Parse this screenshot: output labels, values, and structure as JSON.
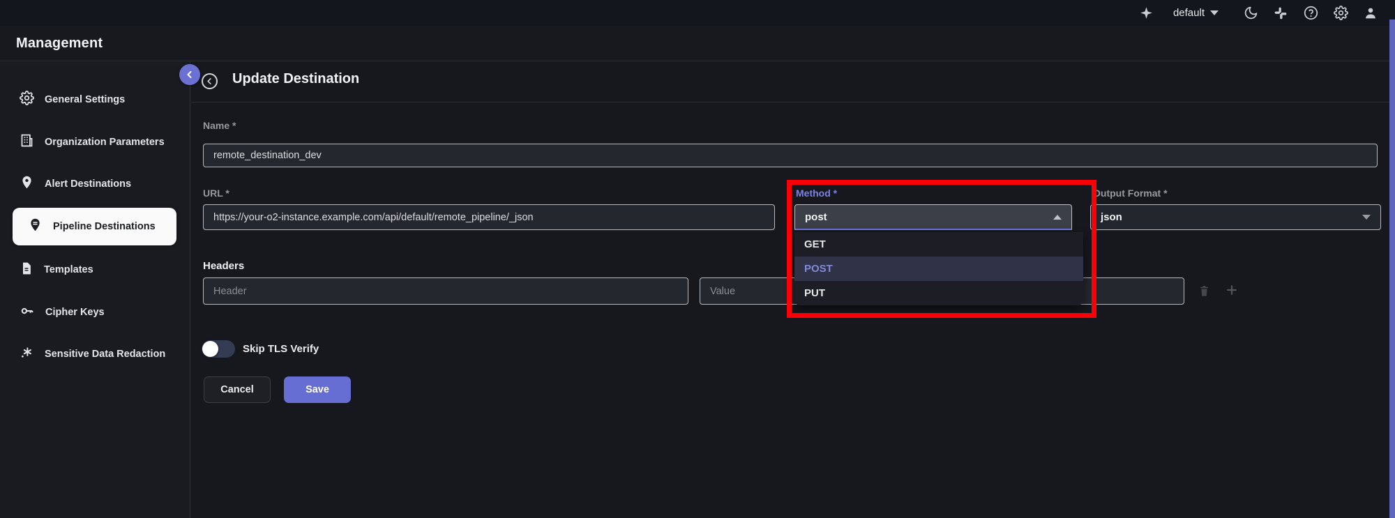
{
  "topbar": {
    "org_selector": {
      "value": "default"
    },
    "icon_names": [
      "sparkle-icon",
      "theme-moon-icon",
      "slack-icon",
      "help-icon",
      "settings-icon",
      "profile-icon"
    ]
  },
  "app_header": {
    "title": "Management"
  },
  "sidebar": {
    "items": [
      {
        "label": "General Settings",
        "icon": "gear-icon",
        "active": false
      },
      {
        "label": "Organization Parameters",
        "icon": "building-icon",
        "active": false
      },
      {
        "label": "Alert Destinations",
        "icon": "map-pin-icon",
        "active": false
      },
      {
        "label": "Pipeline Destinations",
        "icon": "map-pin-filled-icon",
        "active": true
      },
      {
        "label": "Templates",
        "icon": "document-icon",
        "active": false
      },
      {
        "label": "Cipher Keys",
        "icon": "key-icon",
        "active": false
      },
      {
        "label": "Sensitive Data Redaction",
        "icon": "redaction-icon",
        "active": false
      }
    ]
  },
  "page": {
    "title": "Update Destination",
    "fields": {
      "name": {
        "label": "Name *",
        "value": "remote_destination_dev"
      },
      "url": {
        "label": "URL *",
        "value": "https://your-o2-instance.example.com/api/default/remote_pipeline/_json"
      },
      "method": {
        "label": "Method *",
        "value": "post",
        "options": [
          "GET",
          "POST",
          "PUT"
        ],
        "highlighted_option": "POST",
        "open": true
      },
      "output_format": {
        "label": "Output Format *",
        "value": "json"
      },
      "headers": {
        "label": "Headers",
        "header_placeholder": "Header",
        "value_placeholder": "Value"
      },
      "skip_tls_verify": {
        "label": "Skip TLS Verify",
        "enabled": false
      }
    },
    "buttons": {
      "cancel": "Cancel",
      "save": "Save"
    }
  },
  "annotation": {
    "type": "red-highlight-box",
    "target": "method-dropdown"
  },
  "colors": {
    "accent_indigo": "#6c74dd",
    "save_button": "#676ed3",
    "annotation_red": "#fb0007",
    "scrollbar_thumb": "#5e67bd",
    "selected_option_bg": "#303248",
    "selected_option_text": "#8289d9",
    "active_item_bg": "#fafafa"
  }
}
